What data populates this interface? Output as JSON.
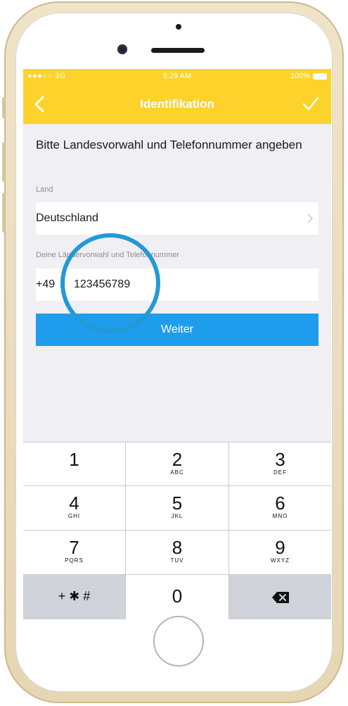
{
  "status_bar": {
    "carrier": "●●●○○ 3G",
    "time": "6:29 AM",
    "battery": "100%"
  },
  "nav": {
    "title": "Identifikation"
  },
  "form": {
    "instruction": "Bitte Landesvorwahl und Telefonnummer angeben",
    "country_label": "Land",
    "country_value": "Deutschland",
    "phone_label": "Deine Ländervorwahl und Telefonnummer",
    "prefix": "+49",
    "phone_number": "123456789",
    "submit_label": "Weiter"
  },
  "keypad": {
    "keys": [
      {
        "digit": "1",
        "letters": ""
      },
      {
        "digit": "2",
        "letters": "ABC"
      },
      {
        "digit": "3",
        "letters": "DEF"
      },
      {
        "digit": "4",
        "letters": "GHI"
      },
      {
        "digit": "5",
        "letters": "JKL"
      },
      {
        "digit": "6",
        "letters": "MNO"
      },
      {
        "digit": "7",
        "letters": "PQRS"
      },
      {
        "digit": "8",
        "letters": "TUV"
      },
      {
        "digit": "9",
        "letters": "WXYZ"
      }
    ],
    "symbols": "+ ✱ #",
    "zero": "0"
  },
  "colors": {
    "accent_yellow": "#fdd22a",
    "button_blue": "#1f9ded",
    "highlight_circle": "#239ad5"
  },
  "icons": {
    "back": "chevron-left-icon",
    "confirm": "checkmark-icon",
    "disclosure": "chevron-right-icon",
    "delete": "backspace-icon"
  }
}
